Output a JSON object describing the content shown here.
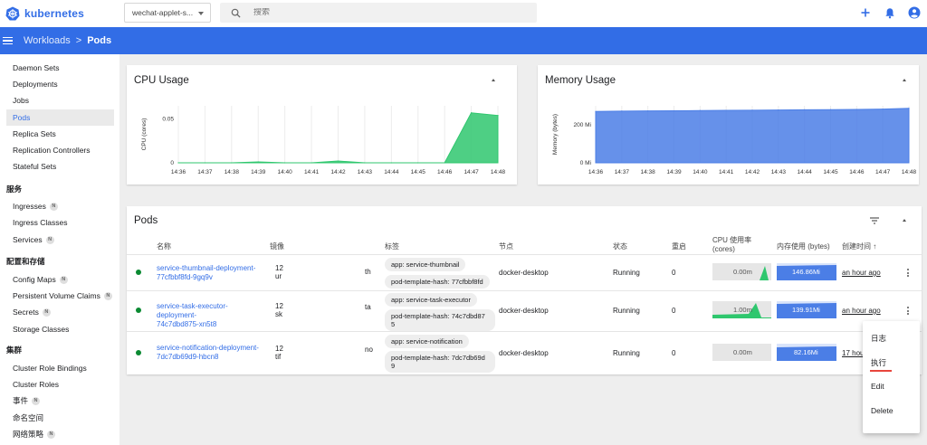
{
  "app": {
    "name": "kubernetes",
    "brand_color": "#326de6"
  },
  "topbar": {
    "namespace": "wechat-applet-s...",
    "search_placeholder": "搜索",
    "actions": [
      "plus-icon",
      "bell-icon",
      "account-icon"
    ]
  },
  "breadcrumb": {
    "parent": "Workloads",
    "separator": ">",
    "current": "Pods"
  },
  "sidebar": {
    "workloads": [
      "Daemon Sets",
      "Deployments",
      "Jobs",
      "Pods",
      "Replica Sets",
      "Replication Controllers",
      "Stateful Sets"
    ],
    "active": "Pods",
    "sections": {
      "services_title": "服务",
      "services": [
        {
          "label": "Ingresses",
          "badge": "N"
        },
        {
          "label": "Ingress Classes",
          "badge": ""
        },
        {
          "label": "Services",
          "badge": "N"
        }
      ],
      "config_title": "配置和存储",
      "config": [
        {
          "label": "Config Maps",
          "badge": "N"
        },
        {
          "label": "Persistent Volume Claims",
          "badge": "N"
        },
        {
          "label": "Secrets",
          "badge": "N"
        },
        {
          "label": "Storage Classes",
          "badge": ""
        }
      ],
      "cluster_title": "集群",
      "cluster": [
        {
          "label": "Cluster Role Bindings",
          "badge": ""
        },
        {
          "label": "Cluster Roles",
          "badge": ""
        },
        {
          "label": "事件",
          "badge": "N"
        },
        {
          "label": "命名空间",
          "badge": ""
        },
        {
          "label": "网络策略",
          "badge": "N"
        }
      ]
    }
  },
  "charts": {
    "cpu_title": "CPU Usage",
    "memory_title": "Memory Usage"
  },
  "chart_data": [
    {
      "type": "area",
      "title": "CPU Usage",
      "ylabel": "CPU (cores)",
      "x": [
        "14:36",
        "14:37",
        "14:38",
        "14:39",
        "14:40",
        "14:41",
        "14:42",
        "14:43",
        "14:44",
        "14:45",
        "14:46",
        "14:47",
        "14:48"
      ],
      "y_ticks": [
        "0",
        "0.05"
      ],
      "ylim": [
        0,
        0.065
      ],
      "color": "#2fc76e",
      "series": [
        {
          "values": [
            0.0,
            0.0,
            0.0,
            0.001,
            0.0,
            0.0,
            0.002,
            0.0,
            0.0,
            0.0,
            0.0,
            0.057,
            0.054
          ]
        }
      ]
    },
    {
      "type": "area",
      "title": "Memory Usage",
      "ylabel": "Memory (bytes)",
      "x": [
        "14:36",
        "14:37",
        "14:38",
        "14:39",
        "14:40",
        "14:41",
        "14:42",
        "14:43",
        "14:44",
        "14:45",
        "14:46",
        "14:47",
        "14:48"
      ],
      "y_ticks": [
        "0 Mi",
        "200 Mi"
      ],
      "ylim": [
        0,
        300
      ],
      "color": "#4b7ee6",
      "series": [
        {
          "values": [
            270,
            272,
            273,
            274,
            275,
            276,
            277,
            278,
            279,
            280,
            281,
            283,
            287
          ]
        }
      ]
    }
  ],
  "pods": {
    "title": "Pods",
    "columns": {
      "name": "名称",
      "image": "镜像",
      "labels": "标签",
      "node": "节点",
      "status": "状态",
      "restarts": "重启",
      "cpu": "CPU 使用率 (cores)",
      "memory": "内存使用 (bytes)",
      "created": "创建时间 ↑"
    },
    "status_color": "#0b8a32",
    "rows": [
      {
        "name_1": "service-thumbnail-deployment-",
        "name_2": "77cfbbf8fd-9gq9v",
        "image_1": "12",
        "image_2": "ur",
        "label_trunc": "th",
        "label_1": "app: service-thumbnail",
        "label_2": "pod-template-hash: 77cfbbf8fd",
        "node": "docker-desktop",
        "status": "Running",
        "restarts": "0",
        "cpu": "0.00m",
        "memory": "146.86Mi",
        "created": "an hour ago"
      },
      {
        "name_1": "service-task-executor-deployment-",
        "name_2": "74c7dbd875-xn5t8",
        "image_1": "12",
        "image_2": "sk",
        "label_trunc": "ta",
        "label_1": "app: service-task-executor",
        "label_2": "pod-template-hash: 74c7dbd87",
        "label_2b": "5",
        "node": "docker-desktop",
        "status": "Running",
        "restarts": "0",
        "cpu": "1.00m",
        "memory": "139.91Mi",
        "created": "an hour ago"
      },
      {
        "name_1": "service-notification-deployment-",
        "name_2": "7dc7db69d9-hbcn8",
        "image_1": "12",
        "image_2": "tif",
        "label_trunc": "no",
        "label_1": "app: service-notification",
        "label_2": "pod-template-hash: 7dc7db69d",
        "label_2b": "9",
        "node": "docker-desktop",
        "status": "Running",
        "restarts": "0",
        "cpu": "0.00m",
        "memory": "82.16Mi",
        "created": "17 hou"
      }
    ]
  },
  "context_menu": {
    "items": [
      "日志",
      "执行",
      "Edit",
      "Delete"
    ],
    "highlight_color": "#e8453c"
  }
}
